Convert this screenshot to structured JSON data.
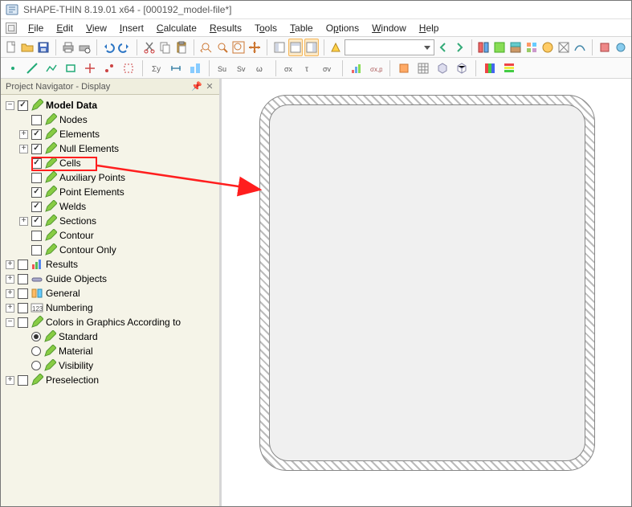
{
  "title": "SHAPE-THIN 8.19.01 x64 - [000192_model-file*]",
  "menus": [
    "File",
    "Edit",
    "View",
    "Insert",
    "Calculate",
    "Results",
    "Tools",
    "Table",
    "Options",
    "Window",
    "Help"
  ],
  "panel_title": "Project Navigator - Display",
  "toolbar_dropdown": "",
  "tree": {
    "root": "Model Data",
    "nodes": "Nodes",
    "elements": "Elements",
    "null_elements": "Null Elements",
    "cells": "Cells",
    "aux_points": "Auxiliary Points",
    "point_elements": "Point Elements",
    "welds": "Welds",
    "sections": "Sections",
    "contour": "Contour",
    "contour_only": "Contour Only",
    "results": "Results",
    "guide_objects": "Guide Objects",
    "general": "General",
    "numbering": "Numbering",
    "colors_group": "Colors in Graphics According to",
    "standard": "Standard",
    "material": "Material",
    "visibility": "Visibility",
    "preselection": "Preselection"
  }
}
